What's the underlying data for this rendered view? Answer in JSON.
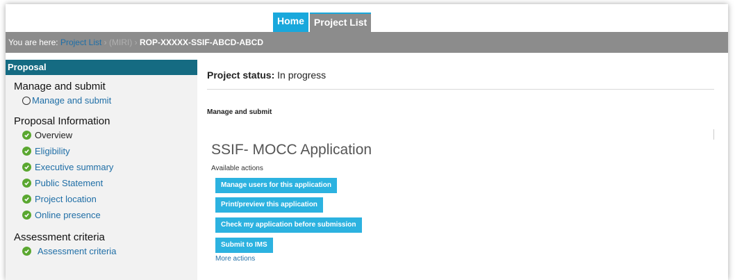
{
  "nav": {
    "home": "Home",
    "project_list": "Project List"
  },
  "breadcrumb": {
    "prefix": "You are here:",
    "project_list": "Project List",
    "faint": "› (MIRI) ›",
    "current": "ROP-XXXXX-SSIF-ABCD-ABCD"
  },
  "sidebar": {
    "header": "Proposal",
    "manage": {
      "title": "Manage and submit",
      "item": "Manage and submit"
    },
    "proposal_info": {
      "title": "Proposal Information",
      "items": [
        "Overview",
        "Eligibility",
        "Executive summary",
        "Public Statement",
        "Project location",
        "Online presence"
      ]
    },
    "assessment": {
      "title": "Assessment criteria",
      "item": "Assessment criteria"
    }
  },
  "main": {
    "status_label": "Project status:",
    "status_value": "In progress",
    "subhead": "Manage and submit",
    "app_title": "SSIF- MOCC Application",
    "available_actions": "Available actions",
    "actions": [
      "Manage users for this application",
      "Print/preview this application",
      "Check my application before submission",
      "Submit to IMS"
    ],
    "more_actions": "More actions"
  },
  "colors": {
    "header_teal": "#156b82",
    "button_blue": "#2cb2e0",
    "tab_blue": "#19a8dc",
    "check_green": "#5aa730",
    "bar_gray": "#8c8c8c"
  }
}
